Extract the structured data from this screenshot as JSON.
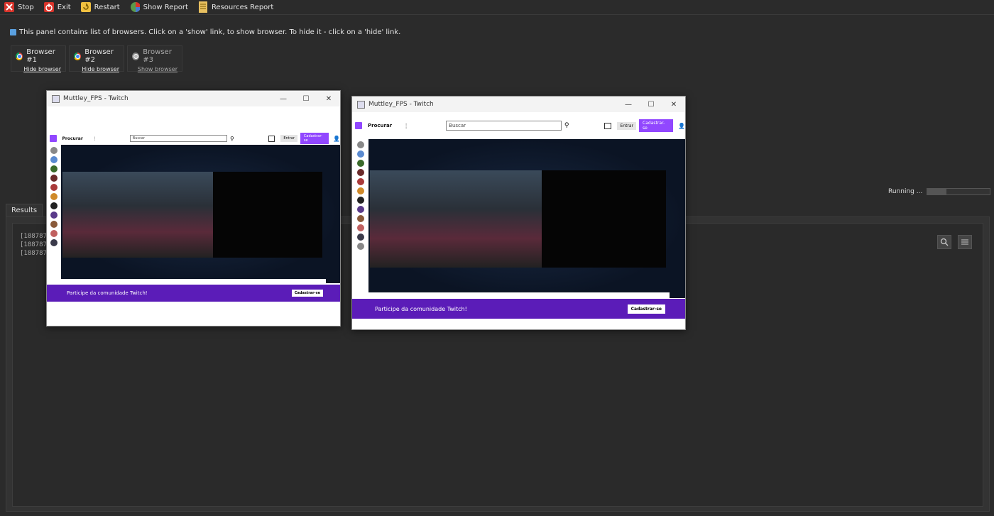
{
  "toolbar": {
    "stop": "Stop",
    "exit": "Exit",
    "restart": "Restart",
    "show_report": "Show Report",
    "resources_report": "Resources Report"
  },
  "info": "This panel contains list of browsers. Click on a 'show' link, to show browser. To hide it - click on a 'hide' link.",
  "browsers": [
    {
      "label": "Browser #1",
      "link": "Hide browser"
    },
    {
      "label": "Browser #2",
      "link": "Hide browser"
    },
    {
      "label": "Browser #3",
      "link": "Show browser"
    }
  ],
  "status": {
    "text": "Running ...",
    "progress": 0.3
  },
  "tabs": {
    "results": "Results"
  },
  "log_lines": [
    "[18878768",
    "[18878768",
    "[18878768"
  ],
  "windows": [
    {
      "title": "Muttley_FPS - Twitch",
      "nav_browse": "Procurar",
      "search_placeholder": "Buscar",
      "login": "Entrar",
      "signup": "Cadastrar-se",
      "banner_text": "Participe da comunidade Twitch!",
      "banner_cta": "Cadastrar-se"
    },
    {
      "title": "Muttley_FPS - Twitch",
      "nav_browse": "Procurar",
      "search_placeholder": "Buscar",
      "login": "Entrar",
      "signup": "Cadastrar-se",
      "banner_text": "Participe da comunidade Twitch!",
      "banner_cta": "Cadastrar-se"
    }
  ],
  "colors": {
    "twitch_purple": "#9147ff",
    "banner_purple": "#5b1cb8",
    "stop_red": "#d9342b"
  }
}
